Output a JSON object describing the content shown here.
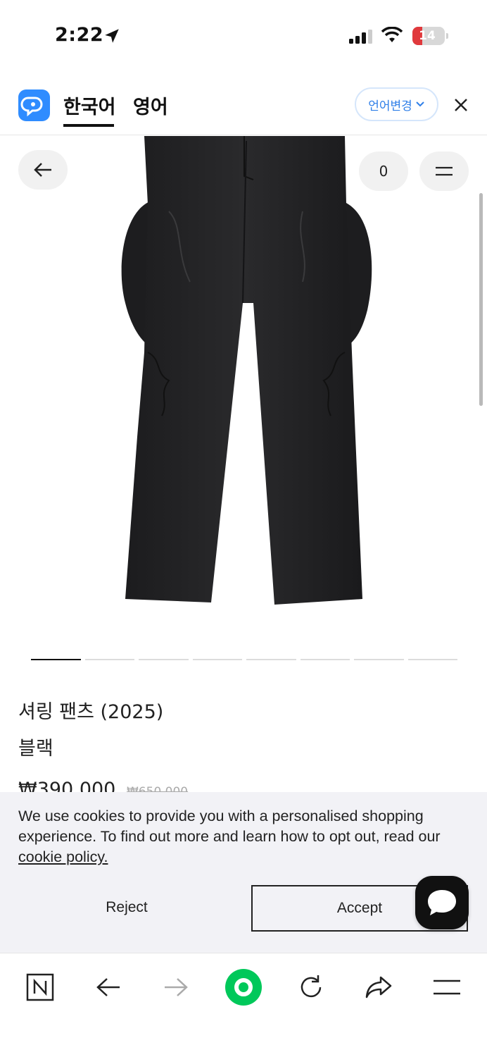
{
  "status_bar": {
    "time": "2:22",
    "battery": "14",
    "icons": [
      "location-arrow-icon",
      "signal-icon",
      "wifi-icon",
      "battery-icon"
    ]
  },
  "translate_bar": {
    "tab_korean": "한국어",
    "tab_english": "영어",
    "change_language": "언어변경",
    "accent_color": "#2f8cff"
  },
  "product": {
    "cart_count": "0",
    "name": "셔링 팬츠 (2025)",
    "color": "블랙",
    "price": "₩390,000",
    "original_price": "₩650,000",
    "image_count": 8,
    "active_image": 1
  },
  "cookie_banner": {
    "message": "We use cookies to provide you with a personalised shopping experience. To find out more and learn how to opt out, read our ",
    "link_text": "cookie policy.",
    "reject_label": "Reject",
    "accept_label": "Accept"
  },
  "browser_toolbar": {
    "icons": [
      "naver-n-icon",
      "back-arrow-icon",
      "forward-arrow-icon",
      "home-green-icon",
      "reload-icon",
      "share-icon",
      "menu-icon"
    ]
  }
}
